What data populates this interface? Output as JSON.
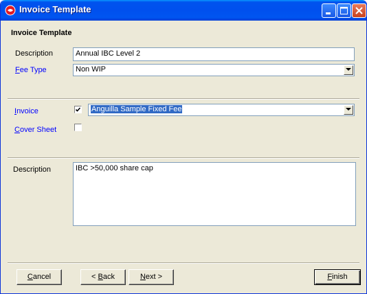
{
  "window": {
    "title": "Invoice Template"
  },
  "section_heading": "Invoice Template",
  "description_field": {
    "label": "Description",
    "value": "Annual IBC Level 2"
  },
  "fee_type": {
    "label_prefix": "F",
    "label_rest": "ee Type",
    "value": "Non WIP"
  },
  "invoice": {
    "label_prefix": "I",
    "label_rest": "nvoice",
    "checked": true,
    "value": "Anguilla Sample Fixed Fee"
  },
  "cover_sheet": {
    "label_prefix": "C",
    "label_rest": "over Sheet",
    "checked": false
  },
  "notes": {
    "label": "Description",
    "value": "IBC >50,000 share cap"
  },
  "buttons": {
    "cancel": {
      "prefix": "C",
      "rest": "ancel"
    },
    "back": {
      "arrow": "< ",
      "prefix": "B",
      "rest": "ack"
    },
    "next": {
      "prefix": "N",
      "rest": "ext >"
    },
    "finish": {
      "prefix": "F",
      "rest": "inish"
    }
  },
  "colors": {
    "titlebar": "#0053ee",
    "face": "#ece9d8",
    "link": "#0000ff",
    "selection": "#316ac5"
  }
}
